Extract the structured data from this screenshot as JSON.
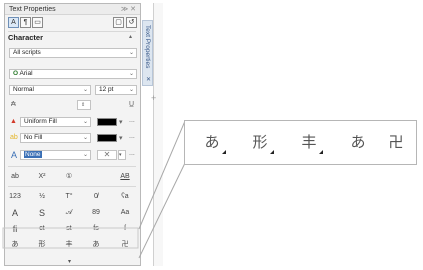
{
  "panel": {
    "title": "Text Properties",
    "title_controls": "≫ ✕",
    "toolbar_icons": [
      "A",
      "¶",
      "▭",
      "▢",
      "↺"
    ],
    "section": "Character",
    "scripts_value": "All scripts",
    "font_icon": "O",
    "font_value": "Arial",
    "style_value": "Normal",
    "size_value": "12 pt",
    "kerning_icon": "₳",
    "fill_value": "Uniform Fill",
    "fill_color": "#000000",
    "bg_fill_value": "No Fill",
    "bg_fill_color": "#000000",
    "outline_value": "None",
    "more": "...",
    "glyph_rows": [
      [
        "ab",
        "X²",
        "①",
        "",
        "AB"
      ],
      [
        "123",
        "½",
        "T°",
        "0̸",
        "ʕa"
      ],
      [
        "A",
        "S",
        "𝒜",
        "89",
        "Aa"
      ],
      [
        "fi",
        "ct",
        "st",
        "fs",
        "ſ"
      ],
      [
        "あ",
        "形",
        "丰",
        "あ",
        "卍"
      ]
    ]
  },
  "side_tab": {
    "label": "Text Properties",
    "close": "✕",
    "plus": "+"
  },
  "callout": {
    "glyphs": [
      "あ",
      "形",
      "丰",
      "あ",
      "卍"
    ]
  },
  "colors": {
    "accent": "#3a6fb5",
    "selection": "#3a6fb5",
    "fill_red": "#d23a2a",
    "fill_yellow": "#e4b62a"
  }
}
